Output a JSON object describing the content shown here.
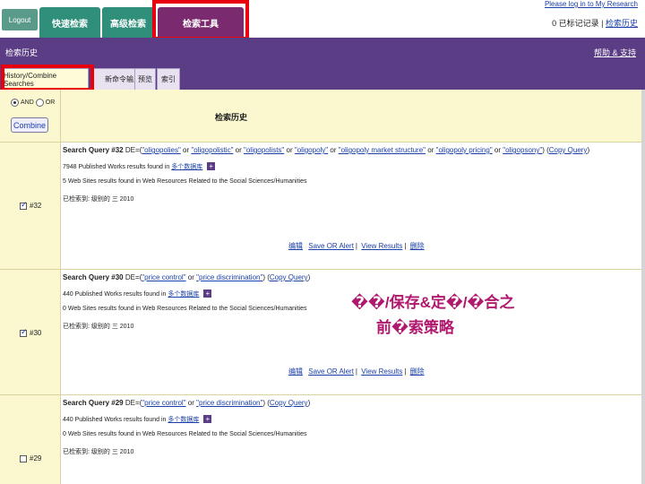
{
  "top": {
    "logout": "Logout",
    "tabs": [
      "快速检索",
      "高级检索",
      "检索工具"
    ],
    "feedback": "Please log in to My Research",
    "marked": "0 已标记记录",
    "search_history_link": "检索历史"
  },
  "header": {
    "title": "检索历史",
    "help": "帮助 & 支持",
    "subtabs": [
      "History/Combine Searches",
      "新命令输入",
      "预览",
      "索引"
    ]
  },
  "combine": {
    "and_label": "AND",
    "or_label": "OR",
    "button": "Combine"
  },
  "history_title": "检索历史",
  "rows": [
    {
      "query_label": "Search Query #32",
      "query_prefix": "DE=(",
      "terms": [
        "\"oligopolies\"",
        "\"oligopolistic\"",
        "\"oligopolists\"",
        "\"oligopoly\"",
        "\"oligopoly market structure\"",
        "\"oligopoly pricing\"",
        "\"oligopsony\""
      ],
      "joiner": "or",
      "query_suffix": ")",
      "copy_query": "Copy Query",
      "published": "7948 Published Works results found in",
      "published_link": "多个数据库",
      "websites": "5 Web Sites results found in Web Resources Related to the Social Sciences/Humanities",
      "saved": "已检索到: 级别的 三 2010",
      "edit": "编辑",
      "save_alert": "Save OR Alert",
      "view_results": "View Results",
      "delete": "删除",
      "checkbox_label": "#32",
      "checked": true
    },
    {
      "query_label": "Search Query #30",
      "query_prefix": "DE=(",
      "terms": [
        "\"price control\"",
        "\"price discrimination\""
      ],
      "joiner": "or",
      "query_suffix": ")",
      "copy_query": "Copy Query",
      "published": "440 Published Works results found in",
      "published_link": "多个数据库",
      "websites": "0 Web Sites results found in Web Resources Related to the Social Sciences/Humanities",
      "saved": "已检索到: 级别的 三 2010",
      "edit": "编辑",
      "save_alert": "Save OR Alert",
      "view_results": "View Results",
      "delete": "删除",
      "checkbox_label": "#30",
      "checked": true
    },
    {
      "query_label": "Search Query #29",
      "query_prefix": "DE=(",
      "terms": [
        "\"price control\"",
        "\"price discrimination\""
      ],
      "joiner": "or",
      "query_suffix": ")",
      "copy_query": "Copy Query",
      "published": "440 Published Works results found in",
      "published_link": "多个数据库",
      "websites": "0 Web Sites results found in Web Resources Related to the Social Sciences/Humanities",
      "saved": "已检索到: 级别的 三 2010",
      "checkbox_label": "#29",
      "checked": false
    }
  ],
  "overlay": {
    "line1": "��/保存&定�/�合之",
    "line2": "前�索策略"
  },
  "colors": {
    "purple": "#5b3d85",
    "teal": "#2f8f7a",
    "highlight_red": "#e8000c",
    "overlay_magenta": "#b0186e"
  }
}
